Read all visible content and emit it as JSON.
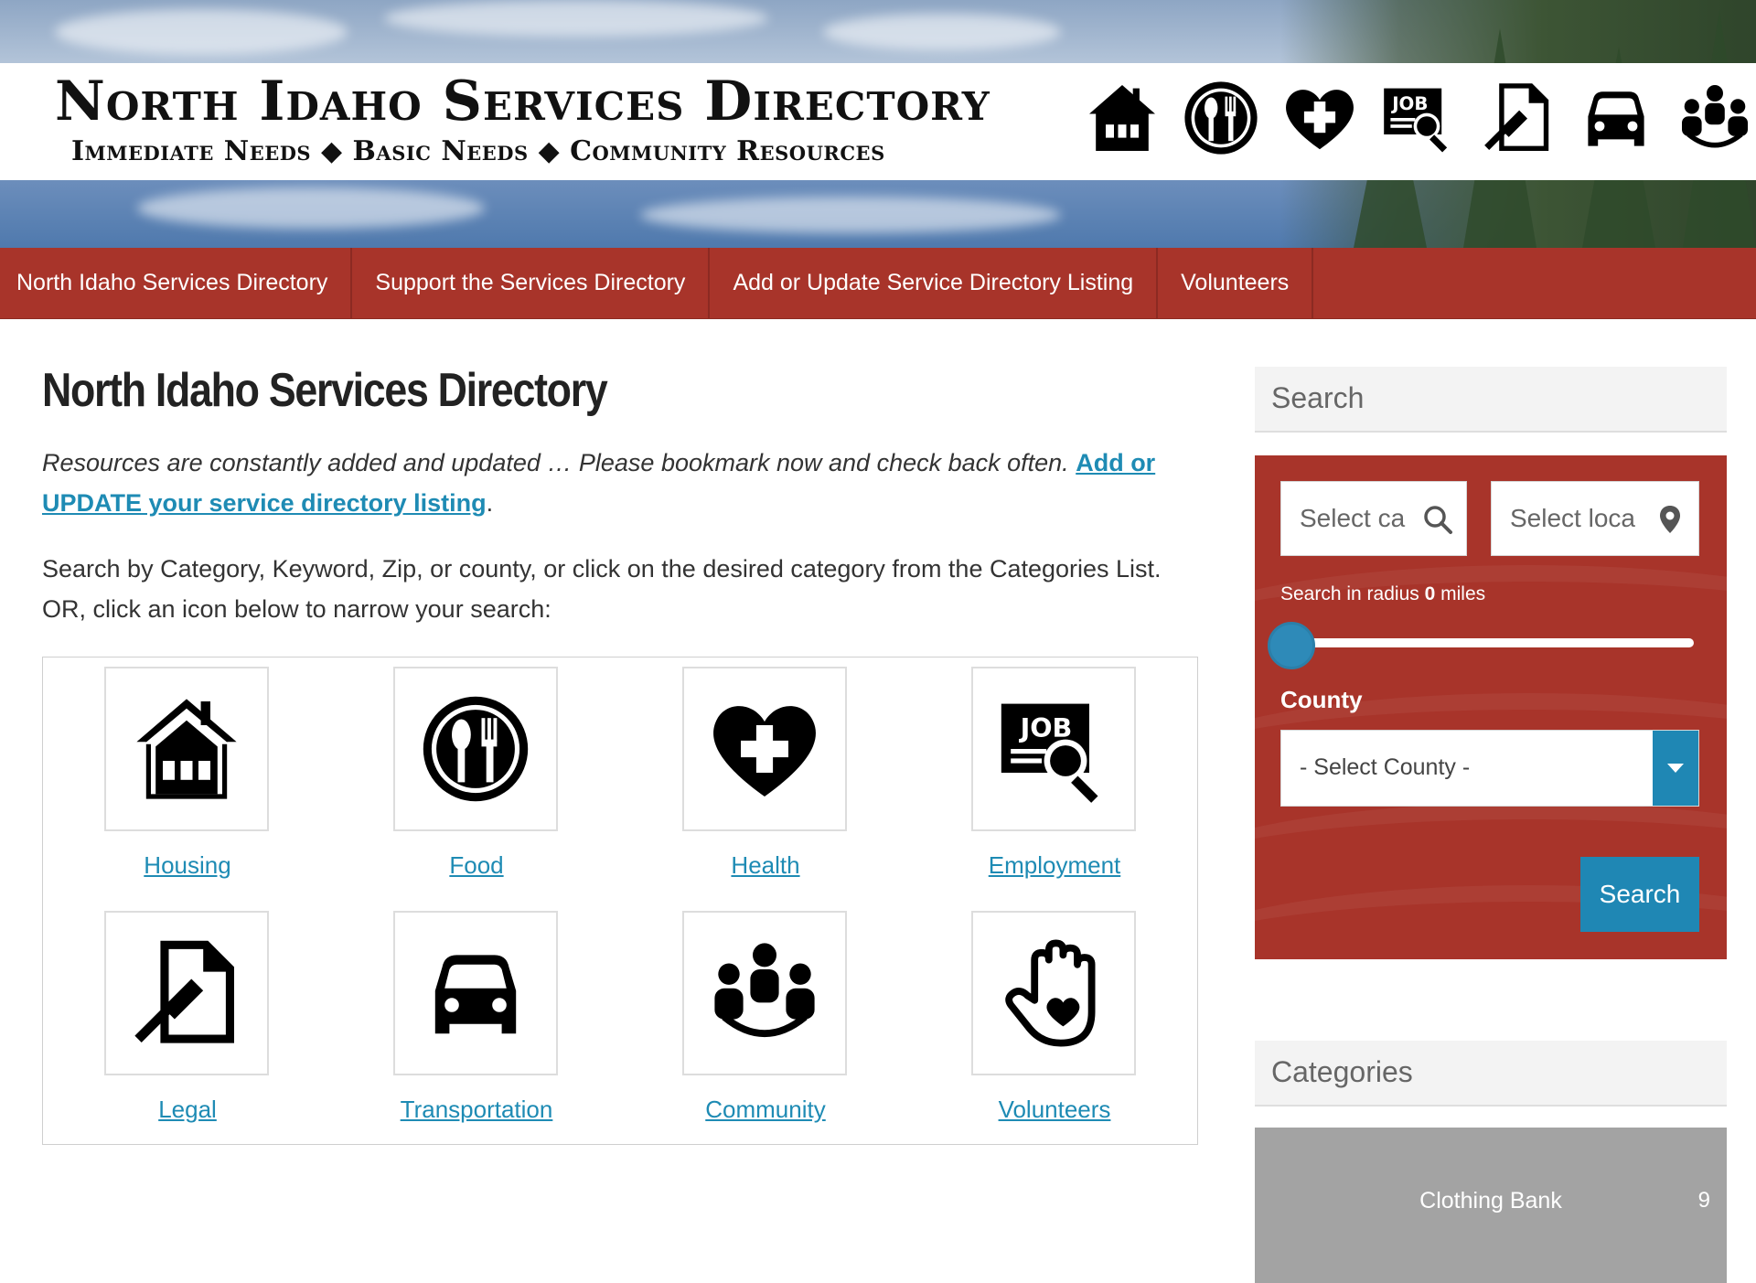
{
  "header": {
    "site_name": "North Idaho Services Directory",
    "tagline": "Immediate Needs ◆ Basic Needs ◆ Community Resources",
    "icons": [
      "house-icon",
      "plate-utensils-icon",
      "heart-cross-icon",
      "job-search-icon",
      "legal-document-icon",
      "car-icon",
      "community-group-icon"
    ]
  },
  "nav": {
    "items": [
      {
        "label": "North Idaho Services Directory"
      },
      {
        "label": "Support the Services Directory"
      },
      {
        "label": "Add or Update Service Directory Listing"
      },
      {
        "label": "Volunteers"
      }
    ]
  },
  "main": {
    "title": "North Idaho Services Directory",
    "intro_text": "Resources are constantly added and updated … Please bookmark now and check back often. ",
    "intro_link": "Add or UPDATE your service directory listing",
    "intro_end": ".",
    "hint_line1": "Search by Category, Keyword, Zip, or county, or click on the desired category from the Categories List.",
    "hint_line2": "OR, click an icon below to narrow your search:",
    "tiles": [
      {
        "label": "Housing",
        "icon": "house-icon"
      },
      {
        "label": "Food",
        "icon": "plate-utensils-icon"
      },
      {
        "label": "Health",
        "icon": "heart-cross-icon"
      },
      {
        "label": "Employment",
        "icon": "job-search-icon"
      },
      {
        "label": "Legal",
        "icon": "legal-document-icon"
      },
      {
        "label": "Transportation",
        "icon": "car-icon"
      },
      {
        "label": "Community",
        "icon": "community-group-icon"
      },
      {
        "label": "Volunteers",
        "icon": "helping-hand-icon"
      }
    ]
  },
  "sidebar": {
    "search_title": "Search",
    "category_placeholder": "Select ca",
    "location_placeholder": "Select loca",
    "radius_prefix": "Search in radius ",
    "radius_value": "0",
    "radius_suffix": " miles",
    "county_label": "County",
    "county_selected": "- Select County -",
    "search_button": "Search",
    "categories_title": "Categories",
    "categories": [
      {
        "name": "Clothing Bank",
        "count": "9"
      }
    ]
  },
  "colors": {
    "nav_red": "#a8342a",
    "link_blue": "#1e8bb4",
    "button_blue": "#1f87b4",
    "category_gray": "#a3a3a3"
  }
}
